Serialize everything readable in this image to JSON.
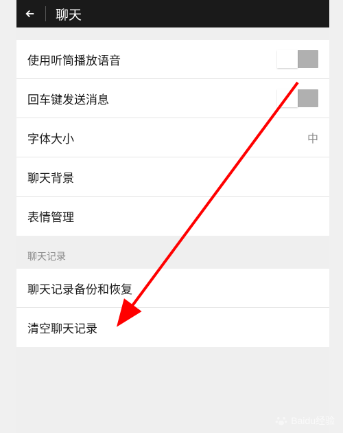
{
  "header": {
    "title": "聊天"
  },
  "items": {
    "voice_speaker": {
      "label": "使用听筒播放语音"
    },
    "enter_send": {
      "label": "回车键发送消息"
    },
    "font_size": {
      "label": "字体大小",
      "value": "中"
    },
    "chat_bg": {
      "label": "聊天背景"
    },
    "emoji_mgmt": {
      "label": "表情管理"
    }
  },
  "section2": {
    "header": "聊天记录",
    "backup_restore": {
      "label": "聊天记录备份和恢复"
    },
    "clear": {
      "label": "清空聊天记录"
    }
  },
  "watermark": "Baidu经验"
}
